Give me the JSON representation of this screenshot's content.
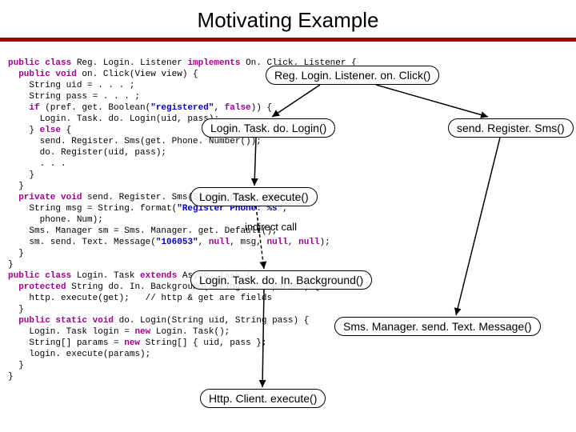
{
  "title": "Motivating Example",
  "code_lines": [
    {
      "type": "plain",
      "indent": 0,
      "segs": [
        {
          "t": "public class",
          "c": "kw"
        },
        {
          "t": " Reg. Login. Listener "
        },
        {
          "t": "implements",
          "c": "kw"
        },
        {
          "t": " On. Click. Listener {"
        }
      ]
    },
    {
      "type": "plain",
      "indent": 1,
      "segs": [
        {
          "t": "public void",
          "c": "kw"
        },
        {
          "t": " on. Click(View view) {"
        }
      ]
    },
    {
      "type": "plain",
      "indent": 2,
      "segs": [
        {
          "t": "String uid = . . . ;"
        }
      ]
    },
    {
      "type": "plain",
      "indent": 2,
      "segs": [
        {
          "t": "String pass = . . . ;"
        }
      ]
    },
    {
      "type": "plain",
      "indent": 2,
      "segs": [
        {
          "t": "if",
          "c": "kw"
        },
        {
          "t": " (pref. get. Boolean("
        },
        {
          "t": "\"registered\"",
          "c": "str"
        },
        {
          "t": ", "
        },
        {
          "t": "false",
          "c": "kw"
        },
        {
          "t": ")) {"
        }
      ]
    },
    {
      "type": "plain",
      "indent": 3,
      "segs": [
        {
          "t": "Login. Task. do. Login(uid, pass);"
        }
      ]
    },
    {
      "type": "plain",
      "indent": 2,
      "segs": [
        {
          "t": "} "
        },
        {
          "t": "else",
          "c": "kw"
        },
        {
          "t": " {"
        }
      ]
    },
    {
      "type": "plain",
      "indent": 3,
      "segs": [
        {
          "t": "send. Register. Sms(get. Phone. Number());"
        }
      ]
    },
    {
      "type": "plain",
      "indent": 3,
      "segs": [
        {
          "t": "do. Register(uid, pass);"
        }
      ]
    },
    {
      "type": "plain",
      "indent": 3,
      "segs": [
        {
          "t": ". . ."
        }
      ]
    },
    {
      "type": "plain",
      "indent": 2,
      "segs": [
        {
          "t": "}"
        }
      ]
    },
    {
      "type": "plain",
      "indent": 1,
      "segs": [
        {
          "t": "}"
        }
      ]
    },
    {
      "type": "plain",
      "indent": 1,
      "segs": [
        {
          "t": "private void",
          "c": "kw"
        },
        {
          "t": " send. Register. Sms(String phone. Num) {"
        }
      ]
    },
    {
      "type": "plain",
      "indent": 2,
      "segs": [
        {
          "t": "String msg = String. format("
        },
        {
          "t": "\"Register Phone: %s\"",
          "c": "str"
        },
        {
          "t": ","
        }
      ]
    },
    {
      "type": "plain",
      "indent": 3,
      "segs": [
        {
          "t": "phone. Num);"
        }
      ]
    },
    {
      "type": "plain",
      "indent": 2,
      "segs": [
        {
          "t": "Sms. Manager sm = Sms. Manager. get. Default();"
        }
      ]
    },
    {
      "type": "plain",
      "indent": 2,
      "segs": [
        {
          "t": "sm. send. Text. Message("
        },
        {
          "t": "\"106053\"",
          "c": "str"
        },
        {
          "t": ", "
        },
        {
          "t": "null",
          "c": "kw"
        },
        {
          "t": ", msg, "
        },
        {
          "t": "null",
          "c": "kw"
        },
        {
          "t": ", "
        },
        {
          "t": "null",
          "c": "kw"
        },
        {
          "t": ");"
        }
      ]
    },
    {
      "type": "plain",
      "indent": 1,
      "segs": [
        {
          "t": "}"
        }
      ]
    },
    {
      "type": "plain",
      "indent": 0,
      "segs": [
        {
          "t": "}"
        }
      ]
    },
    {
      "type": "plain",
      "indent": 0,
      "segs": [
        {
          "t": "public class",
          "c": "kw"
        },
        {
          "t": " Login. Task "
        },
        {
          "t": "extends",
          "c": "kw"
        },
        {
          "t": " Async. Task {"
        }
      ]
    },
    {
      "type": "plain",
      "indent": 1,
      "segs": [
        {
          "t": "protected",
          "c": "kw"
        },
        {
          "t": " String do. In. Background(String. . . params) {"
        }
      ]
    },
    {
      "type": "plain",
      "indent": 2,
      "segs": [
        {
          "t": "http. execute(get);   // http & get are fields"
        }
      ]
    },
    {
      "type": "plain",
      "indent": 1,
      "segs": [
        {
          "t": "}"
        }
      ]
    },
    {
      "type": "plain",
      "indent": 1,
      "segs": [
        {
          "t": "public static void",
          "c": "kw"
        },
        {
          "t": " do. Login(String uid, String pass) {"
        }
      ]
    },
    {
      "type": "plain",
      "indent": 2,
      "segs": [
        {
          "t": "Login. Task login = "
        },
        {
          "t": "new",
          "c": "kw"
        },
        {
          "t": " Login. Task();"
        }
      ]
    },
    {
      "type": "plain",
      "indent": 2,
      "segs": [
        {
          "t": "String[] params = "
        },
        {
          "t": "new",
          "c": "kw"
        },
        {
          "t": " String[] { uid, pass };"
        }
      ]
    },
    {
      "type": "plain",
      "indent": 2,
      "segs": [
        {
          "t": "login. execute(params);"
        }
      ]
    },
    {
      "type": "plain",
      "indent": 1,
      "segs": [
        {
          "t": "}"
        }
      ]
    },
    {
      "type": "plain",
      "indent": 0,
      "segs": [
        {
          "t": "}"
        }
      ]
    }
  ],
  "annotations": {
    "indirect_call": "indirect  call"
  },
  "boxes": {
    "reg_login": "Reg. Login. Listener. on. Click()",
    "do_login": "Login. Task. do. Login()",
    "send_register": "send. Register. Sms()",
    "execute": "Login. Task. execute()",
    "do_inbg": "Login. Task. do. In. Background()",
    "sms_mgr": "Sms. Manager. send. Text. Message()",
    "http": "Http. Client. execute()"
  }
}
